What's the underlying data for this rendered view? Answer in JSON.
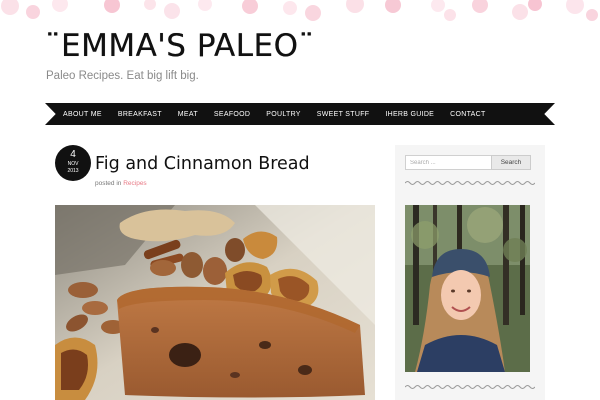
{
  "header": {
    "site_title": "¨EMMA'S PALEO¨",
    "tagline": "Paleo Recipes. Eat big lift big."
  },
  "nav": {
    "items": [
      "ABOUT ME",
      "BREAKFAST",
      "MEAT",
      "SEAFOOD",
      "POULTRY",
      "SWEET STUFF",
      "IHERB GUIDE",
      "CONTACT"
    ]
  },
  "post": {
    "date": {
      "day": "4",
      "month": "NOV",
      "year": "2013"
    },
    "title": "Fig and Cinnamon Bread",
    "posted_in_label": "posted in",
    "category": "Recipes"
  },
  "sidebar": {
    "search": {
      "placeholder": "Search ...",
      "button_label": "Search"
    }
  },
  "colors": {
    "accent": "#e87a86",
    "nav_background": "#111111",
    "dot_pink": "#f7c6d3"
  }
}
